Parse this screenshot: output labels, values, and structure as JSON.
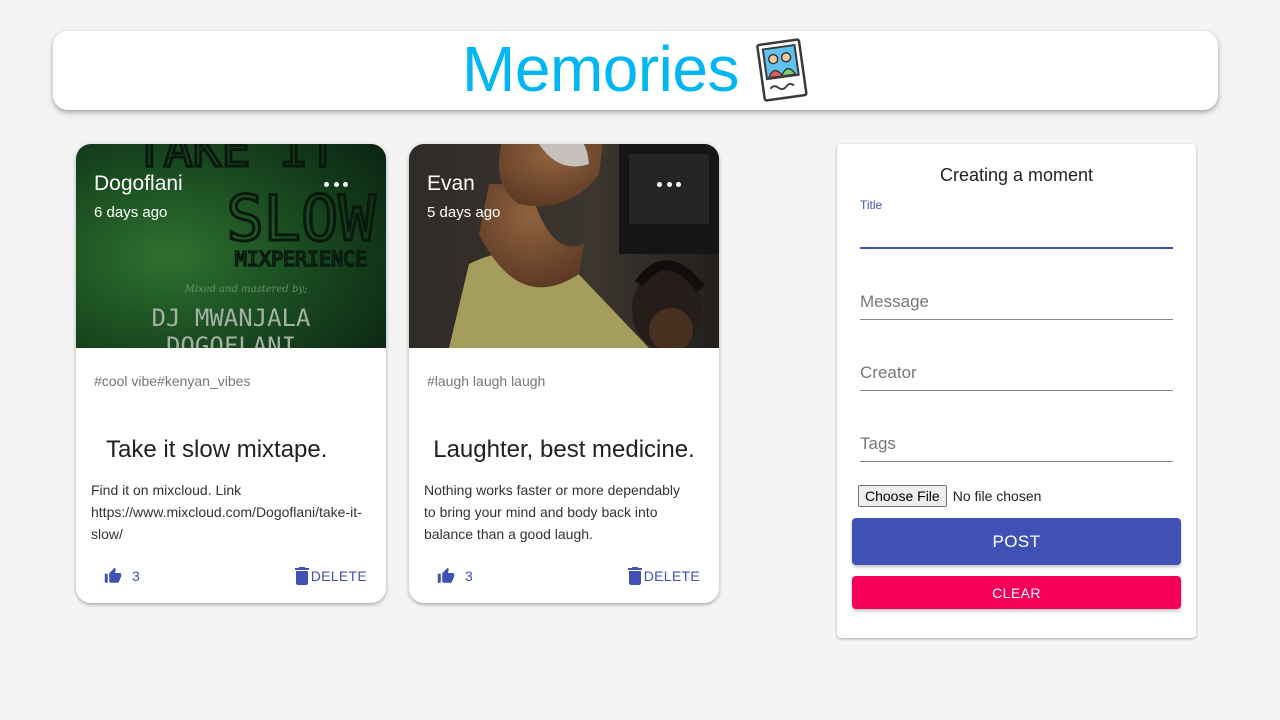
{
  "appbar": {
    "title": "Memories",
    "brand_color": "#00b7f3",
    "logo_icon": "photo-memories-icon"
  },
  "posts": [
    {
      "creator": "Dogoflani",
      "time": "6 days ago",
      "image_text": {
        "line1": "TAKE IT",
        "line2": "SLOW",
        "line3": "MIXPERIENCE",
        "line4": "Mixed and mastered by;",
        "line5": "DJ MWANJALA",
        "line6": "DOGOFLANI"
      },
      "tags": "#cool vibe#kenyan_vibes",
      "title": "Take it slow mixtape.",
      "message": "Find it on mixcloud. Link https://www.mixcloud.com/Dogoflani/take-it-slow/",
      "likes": "3",
      "delete_label": "DELETE"
    },
    {
      "creator": "Evan",
      "time": "5 days ago",
      "tags": "#laugh laugh laugh",
      "title": "Laughter, best medicine.",
      "message": "Nothing works faster or more dependably to bring your mind and body back into balance than a good laugh.",
      "likes": "3",
      "delete_label": "DELETE"
    }
  ],
  "form": {
    "heading": "Creating a moment",
    "title_label": "Title",
    "message_placeholder": "Message",
    "creator_placeholder": "Creator",
    "tags_placeholder": "Tags",
    "file_button": "Choose File",
    "file_status": "No file chosen",
    "post_label": "POST",
    "clear_label": "CLEAR"
  },
  "colors": {
    "primary": "#3f51b5",
    "secondary": "#f50057"
  }
}
